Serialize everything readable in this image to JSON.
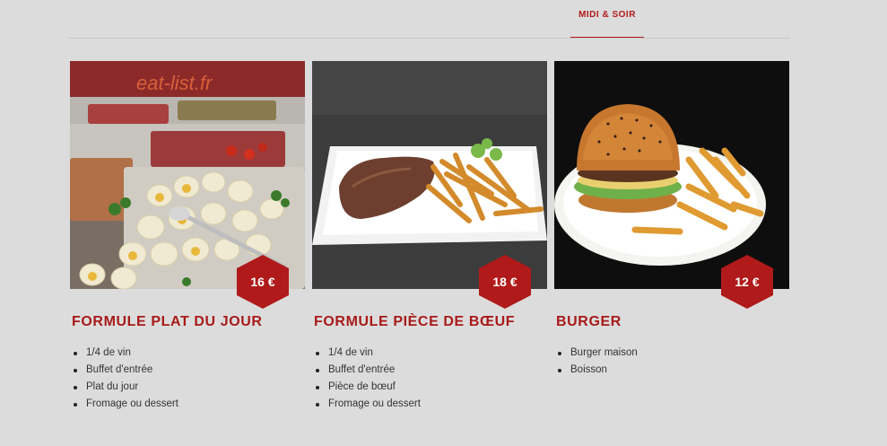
{
  "header": {
    "tab_label": "MIDI & SOIR"
  },
  "watermark": "eat-list.fr",
  "cards": [
    {
      "title": "FORMULE PLAT DU JOUR",
      "price": "16 €",
      "items": [
        "1/4 de vin",
        "Buffet d'entrée",
        "Plat du jour",
        "Fromage ou dessert"
      ]
    },
    {
      "title": "FORMULE PIÈCE DE BŒUF",
      "price": "18 €",
      "items": [
        "1/4 de vin",
        "Buffet d'entrée",
        "Pièce de bœuf",
        "Fromage ou dessert"
      ]
    },
    {
      "title": "BURGER",
      "price": "12 €",
      "items": [
        "Burger maison",
        "Boisson"
      ]
    }
  ],
  "colors": {
    "accent": "#b01a1a",
    "background": "#dcdcdc"
  }
}
